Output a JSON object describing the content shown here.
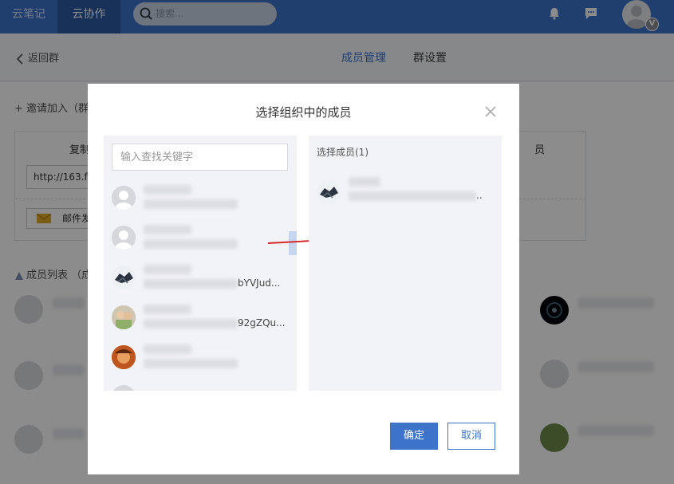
{
  "topbar": {
    "tabs": [
      {
        "label": "云笔记",
        "active": false
      },
      {
        "label": "云协作",
        "active": true
      }
    ],
    "search_placeholder": "搜索...",
    "vip_badge": "V"
  },
  "subheader": {
    "back_label": "返回群",
    "tabs": [
      {
        "label": "成员管理",
        "active": true
      },
      {
        "label": "群设置",
        "active": false
      }
    ]
  },
  "background": {
    "invite_label": "+ 邀请加入（群",
    "copy_label": "复制",
    "link_value": "http://163.fm",
    "mail_label": "邮件发",
    "right_fragment": "员",
    "members_title": "成员列表 （成"
  },
  "modal": {
    "title": "选择组织中的成员",
    "search_placeholder": "输入查找关键字",
    "candidates": [
      {
        "suffix": ""
      },
      {
        "suffix": ""
      },
      {
        "suffix": "bYVJud..."
      },
      {
        "suffix": "92gZQu..."
      },
      {
        "suffix": ""
      }
    ],
    "selected_label": "选择成员(1)",
    "selected_more": "..",
    "confirm_label": "确定",
    "cancel_label": "取消"
  },
  "colors": {
    "brand": "#3d74c9",
    "arrow": "#d42a2a"
  }
}
